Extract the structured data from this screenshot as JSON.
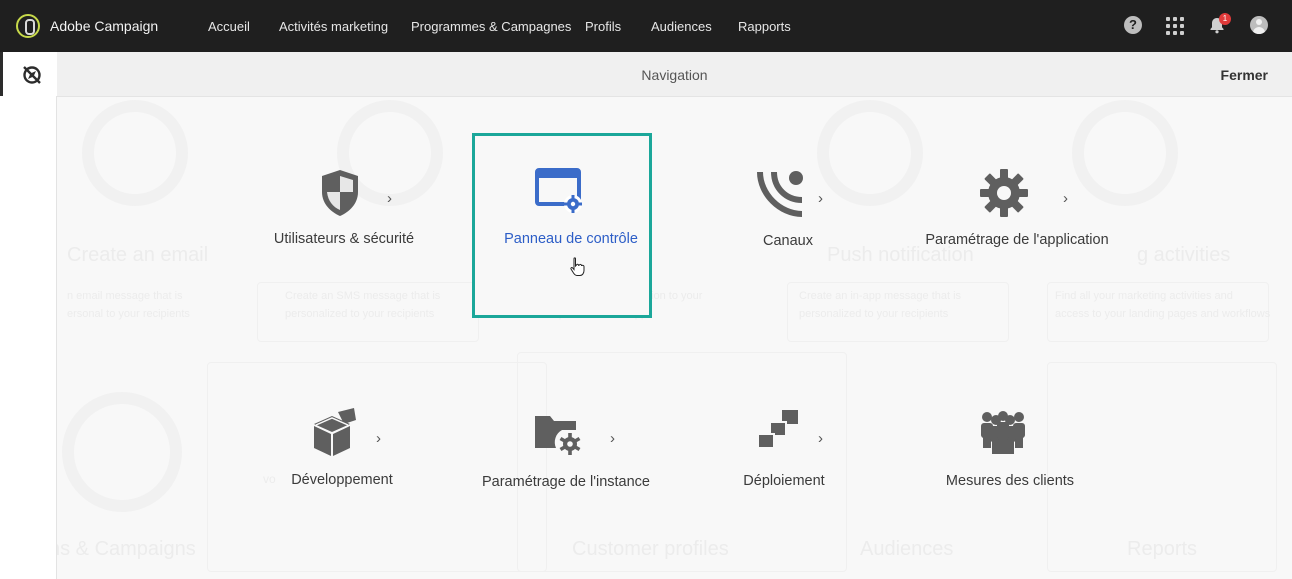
{
  "topbar": {
    "brand": "Adobe Campaign",
    "nav": [
      "Accueil",
      "Activités marketing",
      "Programmes & Campagnes",
      "Profils",
      "Audiences",
      "Rapports"
    ],
    "help_glyph": "?",
    "notification_count": "1"
  },
  "navigation_panel": {
    "title": "Navigation",
    "close_label": "Fermer"
  },
  "tiles": [
    {
      "label": "Utilisateurs & sécurité",
      "icon": "shield-icon",
      "has_submenu": true
    },
    {
      "label": "Panneau de contrôle",
      "icon": "control-panel-icon",
      "has_submenu": false,
      "selected": true
    },
    {
      "label": "Canaux",
      "icon": "channels-icon",
      "has_submenu": true
    },
    {
      "label": "Paramétrage de l'application",
      "icon": "gear-icon",
      "has_submenu": true
    },
    {
      "label": "Développement",
      "icon": "package-icon",
      "has_submenu": true
    },
    {
      "label": "Paramétrage de l'instance",
      "icon": "folder-gear-icon",
      "has_submenu": true
    },
    {
      "label": "Déploiement",
      "icon": "deployment-icon",
      "has_submenu": true
    },
    {
      "label": "Mesures des clients",
      "icon": "people-icon",
      "has_submenu": false
    }
  ],
  "background_ghost": [
    "Create an email",
    "n email message that is",
    "ersonal to your recipients",
    "Create an SMS message that is",
    "personalized to your recipients",
    "Create a push notification to your",
    "recipients' mobile app",
    "Create an in-app message that is",
    "personalized to your recipients",
    "Find all your marketing activities and",
    "access to your landing pages and workflows",
    "ns & Campaigns",
    "Customer profiles",
    "Audiences",
    "Reports",
    "Push notification",
    "g activities",
    "vo"
  ],
  "colors": {
    "topbar_bg": "#1f1f1f",
    "accent_selected_border": "#1ba79a",
    "selected_label": "#2d5ec7",
    "icon_blue": "#3b6cc9",
    "icon_gray": "#5f5f5f",
    "badge_red": "#e03a3a"
  }
}
